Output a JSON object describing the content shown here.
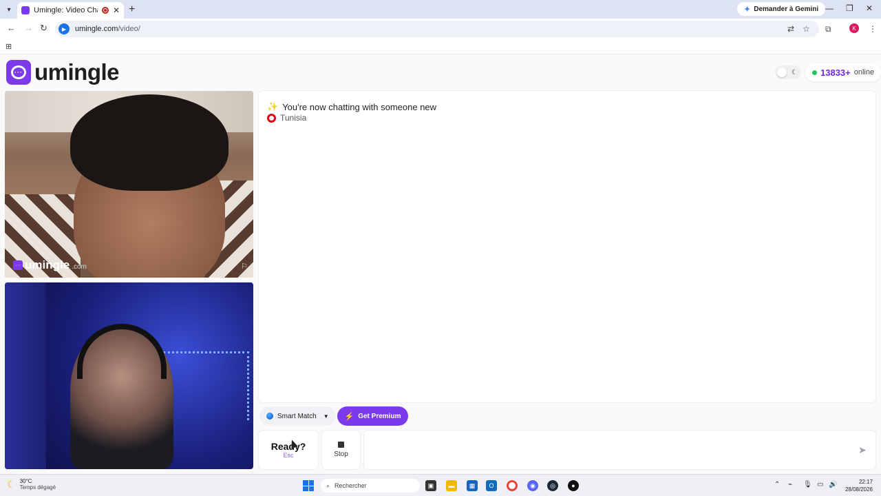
{
  "browser": {
    "tab_title": "Umingle: Video Chat with S",
    "close_tab": "✕",
    "new_tab": "+",
    "gemini_label": "Demander à Gemini",
    "url_host": "umingle.com",
    "url_path": "/video/",
    "profile_initial": "K"
  },
  "header": {
    "logo_text": "umingle",
    "online_count": "13833+",
    "online_label": "online"
  },
  "video": {
    "watermark": "umingle",
    "watermark_suffix": ".com"
  },
  "chat": {
    "status_message": "You're now chatting with someone new",
    "country": "Tunisia"
  },
  "controls": {
    "smart_match": "Smart Match",
    "premium": "Get Premium",
    "ready_label": "Ready?",
    "ready_hint": "Esc",
    "stop_label": "Stop",
    "message_placeholder": ""
  },
  "taskbar": {
    "temperature": "30°C",
    "weather": "Temps dégagé",
    "search_label": "Rechercher",
    "time": "22:17",
    "date": "28/08/2026"
  },
  "colors": {
    "brand": "#7c3aed",
    "online_dot": "#22c55e"
  },
  "icons": [
    "tab-list-icon",
    "record-icon",
    "back-icon",
    "forward-icon",
    "reload-icon",
    "translate-icon",
    "star-icon",
    "extensions-icon",
    "menu-icon",
    "apps-icon",
    "moon-icon",
    "flag-icon",
    "sparkle-icon",
    "globe-icon",
    "bolt-icon",
    "stop-icon",
    "send-icon",
    "windows-icon",
    "search-icon"
  ]
}
